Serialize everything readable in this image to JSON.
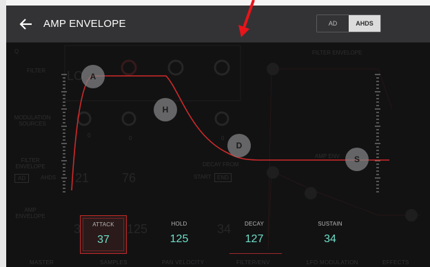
{
  "header": {
    "title": "AMP ENVELOPE",
    "modes": [
      {
        "label": "AD",
        "active": false
      },
      {
        "label": "AHDS",
        "active": true
      }
    ]
  },
  "nodes": [
    {
      "id": "attack-node",
      "label": "A"
    },
    {
      "id": "hold-node",
      "label": "H"
    },
    {
      "id": "decay-node",
      "label": "D"
    },
    {
      "id": "sustain-node",
      "label": "S"
    }
  ],
  "params": [
    {
      "key": "attack",
      "label": "ATTACK",
      "value": "37",
      "selected": true
    },
    {
      "key": "hold",
      "label": "HOLD",
      "value": "125",
      "selected": false
    },
    {
      "key": "decay",
      "label": "DECAY",
      "value": "127",
      "selected": false
    },
    {
      "key": "sustain",
      "label": "SUSTAIN",
      "value": "34",
      "selected": false
    }
  ],
  "background": {
    "labels": {
      "q": "Q",
      "filter": "FILTER",
      "lo": "LO",
      "mod_sources": "MODULATION SOURCES",
      "filter_envelope": "FILTER ENVELOPE",
      "amp_envelope": "AMP ENVELOPE",
      "ad": "AD",
      "ahds": "AHDS",
      "filter_envelope_right": "FILTER ENVELOPE",
      "amp_env_right": "AMP ENV",
      "decay_from": "DECAY FROM",
      "start": "START",
      "end": "END",
      "v21": "21",
      "v76": "76",
      "v37": "37",
      "v125": "125",
      "v34": "34",
      "v0a": "0",
      "v0b": "0",
      "v0c": "0"
    },
    "tabs": [
      "MASTER",
      "SAMPLES",
      "PAN VELOCITY",
      "FILTER/ENV",
      "LFO MODULATION",
      "EFFECTS"
    ]
  },
  "colors": {
    "accent_red": "#d12a2a",
    "value_teal": "#6fe0c9",
    "header_bg": "#333335",
    "bg": "#121213"
  }
}
